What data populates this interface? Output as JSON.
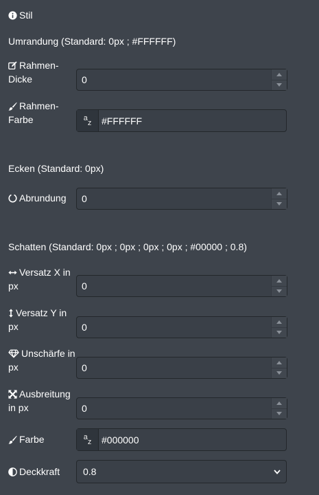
{
  "header": {
    "title": "Stil",
    "icon": "info-circle-icon"
  },
  "border": {
    "section_title": "Umrandung (Standard: 0px ; #FFFFFF)",
    "thickness_label_1": "Rahmen-",
    "thickness_label_2": "Dicke",
    "thickness_value": "0",
    "color_label_1": "Rahmen-",
    "color_label_2": "Farbe",
    "color_value": "#FFFFFF"
  },
  "corners": {
    "section_title": "Ecken (Standard: 0px)",
    "rounding_label": "Abrundung",
    "rounding_value": "0"
  },
  "shadow": {
    "section_title": "Schatten (Standard: 0px ; 0px ; 0px ; 0px ; #00000 ; 0.8)",
    "offset_x_label_1": "Versatz X in",
    "offset_x_label_2": "px",
    "offset_x_value": "0",
    "offset_y_label_1": "Versatz Y in",
    "offset_y_label_2": "px",
    "offset_y_value": "0",
    "blur_label_1": "Unschärfe in",
    "blur_label_2": "px",
    "blur_value": "0",
    "spread_label_1": "Ausbreitung",
    "spread_label_2": "in px",
    "spread_value": "0",
    "color_label": "Farbe",
    "color_value": "#000000",
    "opacity_label": "Deckkraft",
    "opacity_value": "0.8"
  },
  "colors": {
    "background": "#3e444c",
    "input_bg": "#3a4048",
    "border": "#23272b"
  }
}
